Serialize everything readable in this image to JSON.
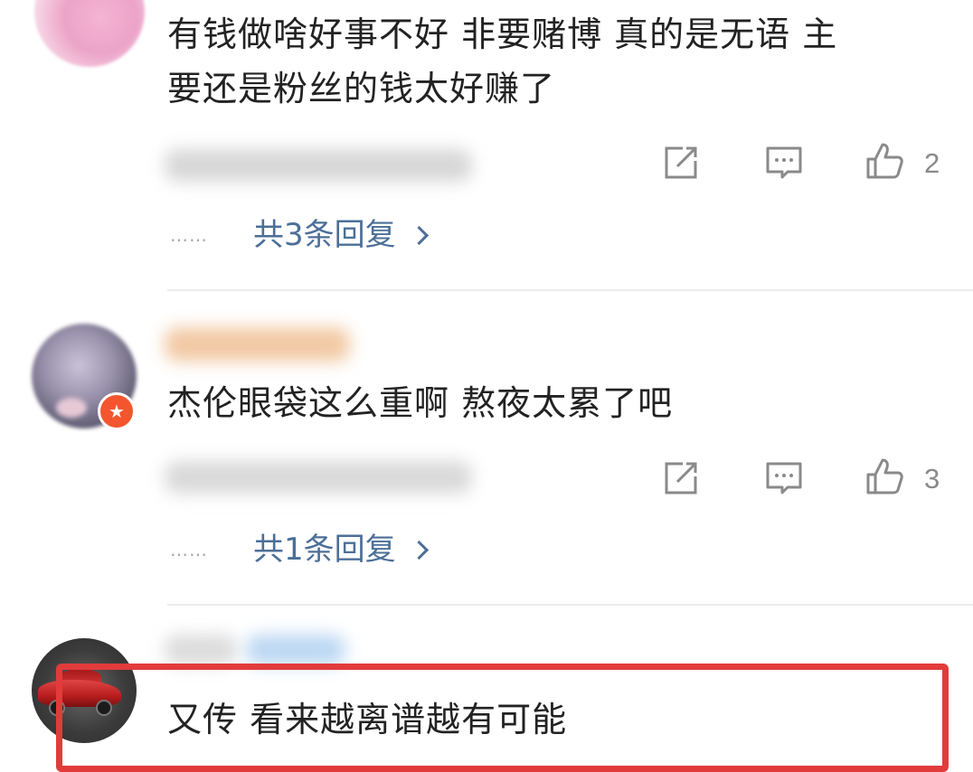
{
  "comments": [
    {
      "text_line1": "有钱做啥好事不好 非要赌博 真的是无语 主",
      "text_line2": "要还是粉丝的钱太好赚了",
      "likes": "2",
      "replies_label": "共3条回复"
    },
    {
      "text": "杰伦眼袋这么重啊 熬夜太累了吧",
      "likes": "3",
      "replies_label": "共1条回复"
    },
    {
      "text": "又传 看来越离谱越有可能"
    }
  ],
  "reply_dots": "……",
  "colors": {
    "reply_link": "#4c6f98",
    "icon_gray": "#8a8a8a",
    "highlight_border": "#e23b3b",
    "vip_badge": "#f3562e"
  },
  "icons": [
    "share-icon",
    "comment-icon",
    "like-icon",
    "chevron-right-icon",
    "vip-badge-icon"
  ]
}
